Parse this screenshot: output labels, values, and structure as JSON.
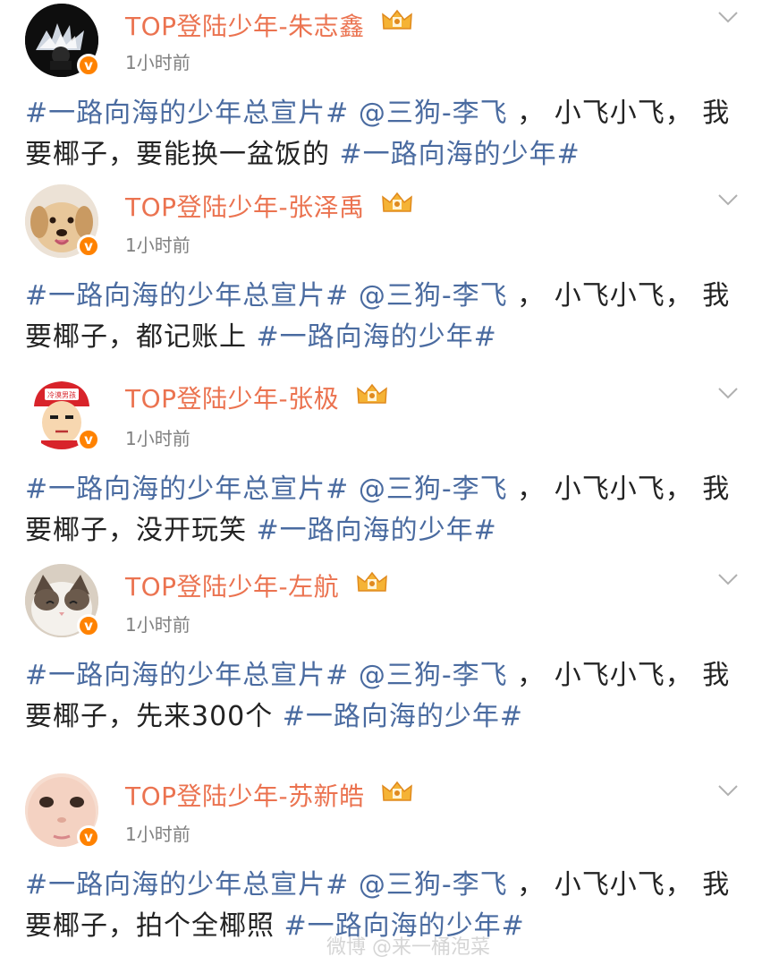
{
  "colors": {
    "username": "#eb7350",
    "link": "#4a6ba0",
    "badge": "#ff8200",
    "time": "#808080"
  },
  "posts": [
    {
      "username": "TOP登陆少年-朱志鑫",
      "time": "1小时前",
      "avatar_icon": "angel-wing-avatar-icon",
      "parts": [
        {
          "text": "#一路向海的少年总宣片#",
          "type": "tag"
        },
        {
          "text": " @三狗-李飞",
          "type": "tag"
        },
        {
          "text": " ， 小飞小飞， 我要椰子，要能换一盆饭的 ",
          "type": "text"
        },
        {
          "text": "#一路向海的少年#",
          "type": "tag"
        }
      ]
    },
    {
      "username": "TOP登陆少年-张泽禹",
      "time": "1小时前",
      "avatar_icon": "puppy-avatar-icon",
      "parts": [
        {
          "text": "#一路向海的少年总宣片#",
          "type": "tag"
        },
        {
          "text": " @三狗-李飞",
          "type": "tag"
        },
        {
          "text": " ， 小飞小飞， 我要椰子，都记账上 ",
          "type": "text"
        },
        {
          "text": "#一路向海的少年#",
          "type": "tag"
        }
      ]
    },
    {
      "username": "TOP登陆少年-张极",
      "time": "1小时前",
      "avatar_icon": "cartoon-boy-avatar-icon",
      "avatar_cap_text": "冷漠男孩",
      "parts": [
        {
          "text": "#一路向海的少年总宣片#",
          "type": "tag"
        },
        {
          "text": " @三狗-李飞",
          "type": "tag"
        },
        {
          "text": " ， 小飞小飞， 我要椰子，没开玩笑 ",
          "type": "text"
        },
        {
          "text": "#一路向海的少年#",
          "type": "tag"
        }
      ]
    },
    {
      "username": "TOP登陆少年-左航",
      "time": "1小时前",
      "avatar_icon": "cat-avatar-icon",
      "parts": [
        {
          "text": "#一路向海的少年总宣片#",
          "type": "tag"
        },
        {
          "text": " @三狗-李飞",
          "type": "tag"
        },
        {
          "text": " ， 小飞小飞， 我要椰子，先来300个 ",
          "type": "text"
        },
        {
          "text": "#一路向海的少年#",
          "type": "tag"
        }
      ]
    },
    {
      "username": "TOP登陆少年-苏新皓",
      "time": "1小时前",
      "avatar_icon": "face-closeup-avatar-icon",
      "parts": [
        {
          "text": "#一路向海的少年总宣片#",
          "type": "tag"
        },
        {
          "text": " @三狗-李飞",
          "type": "tag"
        },
        {
          "text": " ， 小飞小飞， 我要椰子，拍个全椰照 ",
          "type": "text"
        },
        {
          "text": "#一路向海的少年#",
          "type": "tag"
        }
      ]
    }
  ],
  "verified_badge_glyph": "v",
  "watermark": "微博 @来一桶泡菜"
}
